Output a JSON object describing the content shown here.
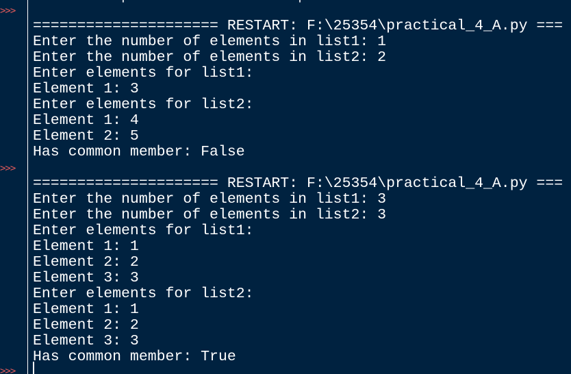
{
  "prompts": [
    ">>>",
    ">>>",
    ">>>"
  ],
  "top_partial": "          p                   p",
  "session1": {
    "restart": "===================== RESTART: F:\\25354\\practical_4_A.py ===",
    "lines": [
      "Enter the number of elements in list1: 1",
      "Enter the number of elements in list2: 2",
      "Enter elements for list1:",
      "Element 1: 3",
      "Enter elements for list2:",
      "Element 1: 4",
      "Element 2: 5",
      "Has common member: False"
    ]
  },
  "session2": {
    "restart": "===================== RESTART: F:\\25354\\practical_4_A.py ===",
    "lines": [
      "Enter the number of elements in list1: 3",
      "Enter the number of elements in list2: 3",
      "Enter elements for list1:",
      "Element 1: 1",
      "Element 2: 2",
      "Element 3: 3",
      "Enter elements for list2:",
      "Element 1: 1",
      "Element 2: 2",
      "Element 3: 3",
      "Has common member: True"
    ]
  },
  "colors": {
    "background": "#002240",
    "text": "#ffffff",
    "prompt": "#e25a5a"
  }
}
